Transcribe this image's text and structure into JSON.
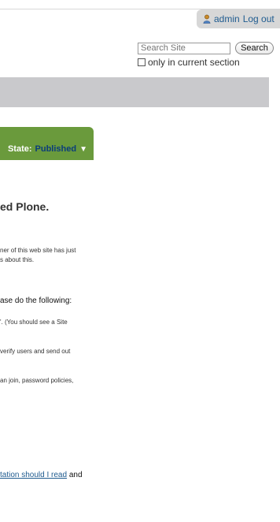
{
  "personal_bar": {
    "user": "admin",
    "logout": "Log out"
  },
  "search": {
    "placeholder": "Search Site",
    "button": "Search",
    "section_label": "only in current section"
  },
  "state": {
    "label": "State:",
    "value": "Published",
    "arrow": "▼"
  },
  "content": {
    "heading": "ed Plone.",
    "para1_line1": "ner of this web site has just",
    "para1_line2": "s about this.",
    "subheading": "ase do the following:",
    "item1": "'. (You should see a Site",
    "item2": "verify users and send out",
    "item3": "an join, password policies,",
    "link_text": "tation should I read",
    "link_tail": " and"
  }
}
